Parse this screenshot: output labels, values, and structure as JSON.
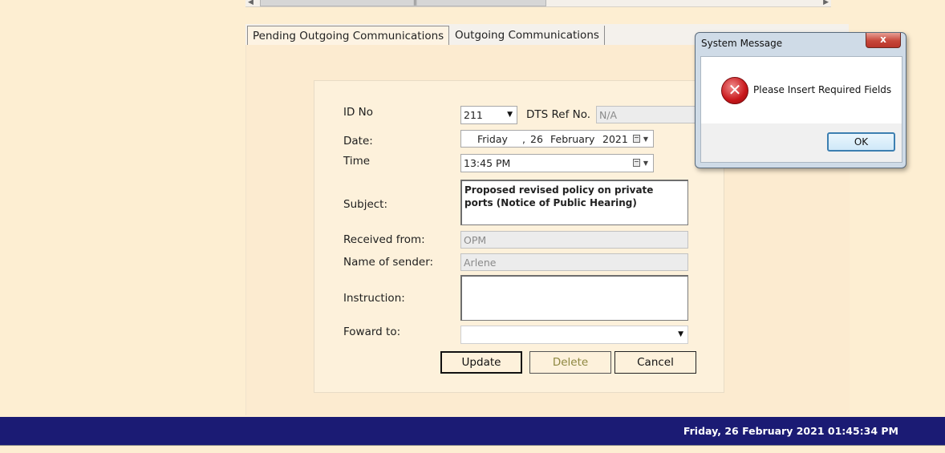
{
  "tabs": [
    {
      "label": "Pending Outgoing Communications",
      "active": true
    },
    {
      "label": "Outgoing Communications",
      "active": false
    }
  ],
  "form": {
    "id_no_label": "ID No",
    "id_no_value": "211",
    "dts_ref_label": "DTS Ref No.",
    "dts_ref_value": "N/A",
    "date_label": "Date:",
    "date_day": "Friday",
    "date_sep": ",",
    "date_daynum": "26",
    "date_month": "February",
    "date_year": "2021",
    "time_label": "Time",
    "time_value": "13:45 PM",
    "subject_label": "Subject:",
    "subject_value": "Proposed revised policy on private ports (Notice of Public Hearing)",
    "received_from_label": "Received from:",
    "received_from_value": "OPM",
    "sender_label": "Name of sender:",
    "sender_value": "Arlene",
    "instruction_label": "Instruction:",
    "instruction_value": "",
    "forward_label": "Foward to:",
    "forward_value": ""
  },
  "buttons": {
    "update": "Update",
    "delete": "Delete",
    "cancel": "Cancel"
  },
  "dialog": {
    "title": "System Message",
    "close": "x",
    "message": "Please Insert Required Fields",
    "icon": "error-icon",
    "ok": "OK"
  },
  "statusbar": {
    "datetime": "Friday, 26 February 2021 01:45:34 PM"
  },
  "colors": {
    "background": "#fdeed2",
    "statusbar": "#1b1b74",
    "error": "#c8161a"
  }
}
